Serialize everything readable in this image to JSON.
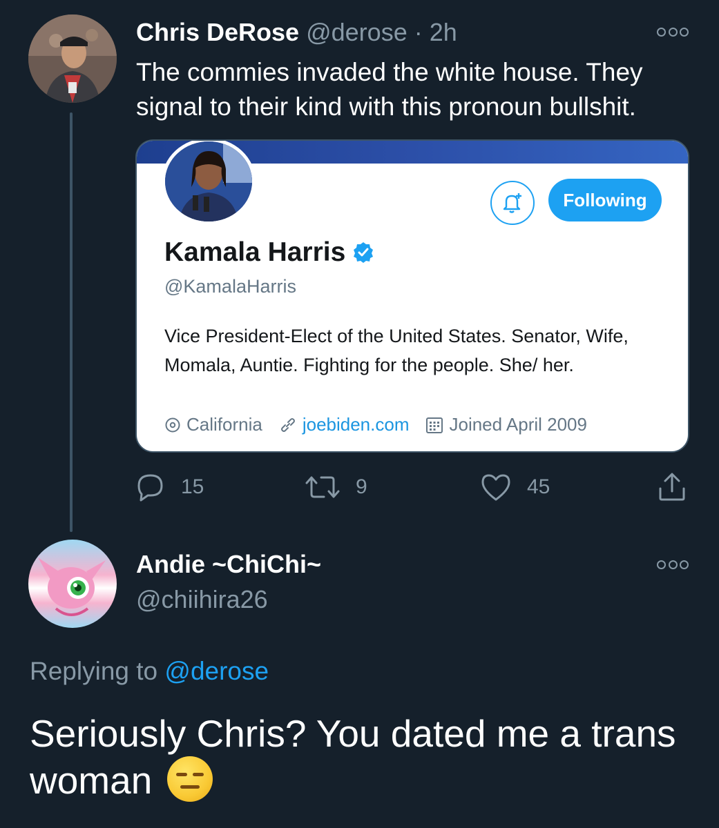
{
  "tweet": {
    "author_name": "Chris DeRose",
    "author_handle": "@derose",
    "separator": "·",
    "time": "2h",
    "text": "The commies invaded the white house. They signal to their kind with this pronoun bullshit.",
    "actions": {
      "replies": "15",
      "retweets": "9",
      "likes": "45"
    }
  },
  "embedded_profile": {
    "name": "Kamala Harris",
    "handle": "@KamalaHarris",
    "follow_button": "Following",
    "bio": "Vice President-Elect of the United States. Senator, Wife, Momala, Auntie. Fighting for the people. She/ her.",
    "location": "California",
    "website": "joebiden.com",
    "joined": "Joined April 2009"
  },
  "reply": {
    "author_name": "Andie ~ChiChi~",
    "author_handle": "@chiihira26",
    "replying_prefix": "Replying to",
    "replying_to": "@derose",
    "text": "Seriously Chris? You dated me a trans woman"
  },
  "colors": {
    "background": "#15202b",
    "accent": "#1da1f2",
    "muted": "#8899a6"
  }
}
